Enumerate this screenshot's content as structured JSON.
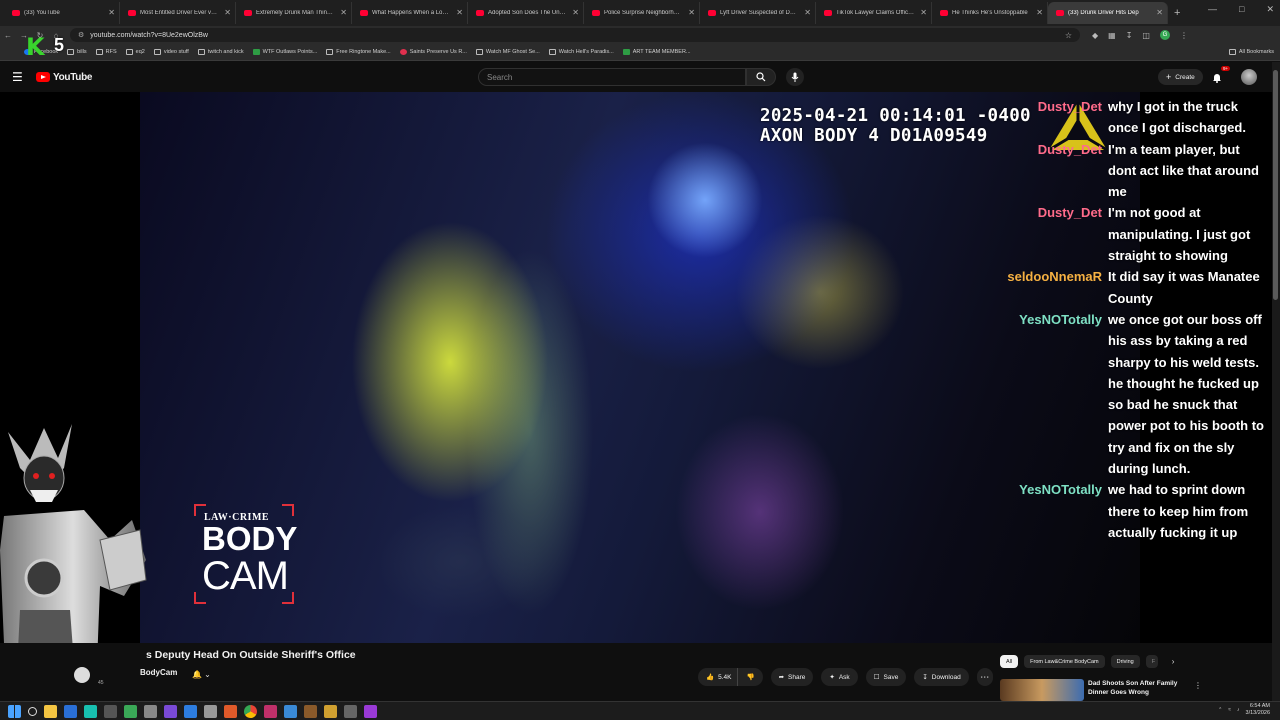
{
  "browser": {
    "tabs": [
      {
        "title": "(33) YouTube",
        "active": false
      },
      {
        "title": "Most Entitled Driver Ever vs B",
        "active": false
      },
      {
        "title": "Extremely Drunk Man Thinks H",
        "active": false
      },
      {
        "title": "What Happens When a Love T",
        "active": false
      },
      {
        "title": "Adopted Son Does The Unthin",
        "active": false
      },
      {
        "title": "Police Surprise Neighborhood",
        "active": false
      },
      {
        "title": "Lyft Driver Suspected of DUI A",
        "active": false
      },
      {
        "title": "TikTok Lawyer Claims Officer G",
        "active": false
      },
      {
        "title": "He Thinks He's Unstoppable",
        "active": false
      },
      {
        "title": "(33) Drunk Driver Hits Dep",
        "active": true
      }
    ],
    "url": "youtube.com/watch?v=8Ue2ewOlzBw",
    "bookmarks": [
      "Facebook",
      "bills",
      "RFS",
      "eq2",
      "video stuff",
      "twitch and kick",
      "WTF Outlaws Points...",
      "Free Ringtone Make...",
      "Saints Preserve Us R...",
      "Watch MF Ghost Se...",
      "Watch Hell's Paradis...",
      "ART TEAM MEMBER..."
    ],
    "all_bookmarks": "All Bookmarks",
    "profile_initial": "G"
  },
  "overlay_logo": {
    "letter": "K",
    "number": "5"
  },
  "youtube": {
    "logo_text": "YouTube",
    "search_placeholder": "Search",
    "create_label": "Create",
    "notif_badge": "9+"
  },
  "video": {
    "timestamp_line1": "2025-04-21 00:14:01 -0400",
    "timestamp_line2": "AXON BODY 4 D01A09549",
    "brand_small": "LAW·CRIME",
    "brand_body": "BODY",
    "brand_cam": "CAM"
  },
  "chat": [
    {
      "user": "Dusty_Det",
      "color": "#ff6b8a",
      "text": "why I got in the truck once I got discharged."
    },
    {
      "user": "Dusty_Det",
      "color": "#ff6b8a",
      "text": "I'm a team player, but dont act like that around me"
    },
    {
      "user": "Dusty_Det",
      "color": "#ff6b8a",
      "text": "I'm not good at manipulating. I just got straight to showing"
    },
    {
      "user": "seldooNnemaR",
      "color": "#f5b042",
      "text": "It did say it was Manatee County"
    },
    {
      "user": "YesNOTotally",
      "color": "#7ee0c4",
      "text": "we once got our boss off his ass by taking a red sharpy to his weld tests. he thought he fucked up so bad he snuck that power pot to his booth to try and fix on the sly during lunch."
    },
    {
      "user": "YesNOTotally",
      "color": "#7ee0c4",
      "text": "we had to sprint down there to keep him from actually fucking it up"
    }
  ],
  "below": {
    "title": "s Deputy Head On Outside Sheriff's Office",
    "channel": "BodyCam",
    "subs": "45",
    "like_count": "5.4K",
    "share": "Share",
    "ask": "Ask",
    "save": "Save",
    "download": "Download",
    "chips": [
      "All",
      "From Law&Crime BodyCam",
      "Driving",
      "F"
    ],
    "rec_title": "Dad Shoots Son After Family Dinner Goes Wrong"
  },
  "taskbar": {
    "time": "6:54 AM",
    "date": "3/13/2026"
  }
}
